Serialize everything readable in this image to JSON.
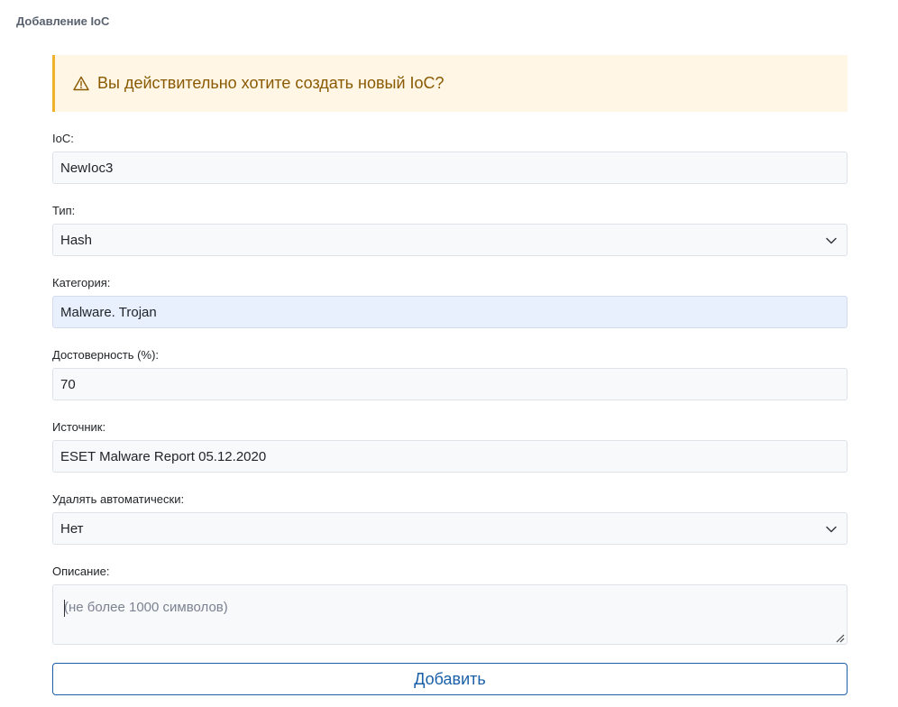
{
  "page": {
    "title": "Добавление IoC"
  },
  "alert": {
    "message": "Вы действительно хотите создать новый IoC?",
    "icon": "warning-icon"
  },
  "fields": {
    "ioc": {
      "label": "IoC:",
      "value": "NewIoc3"
    },
    "type": {
      "label": "Тип:",
      "value": "Hash"
    },
    "category": {
      "label": "Категория:",
      "value": "Malware. Trojan"
    },
    "confidence": {
      "label": "Достоверность (%):",
      "value": "70"
    },
    "source": {
      "label": "Источник:",
      "value": "ESET Malware Report 05.12.2020"
    },
    "auto_delete": {
      "label": "Удалять автоматически:",
      "value": "Нет"
    },
    "description": {
      "label": "Описание:",
      "placeholder": "(не более 1000 символов)"
    }
  },
  "submit": {
    "label": "Добавить"
  },
  "colors": {
    "accent": "#1a5fa8",
    "warning_bg": "#fff6e6",
    "warning_border": "#f0b12a",
    "warning_text": "#8a5a00"
  }
}
